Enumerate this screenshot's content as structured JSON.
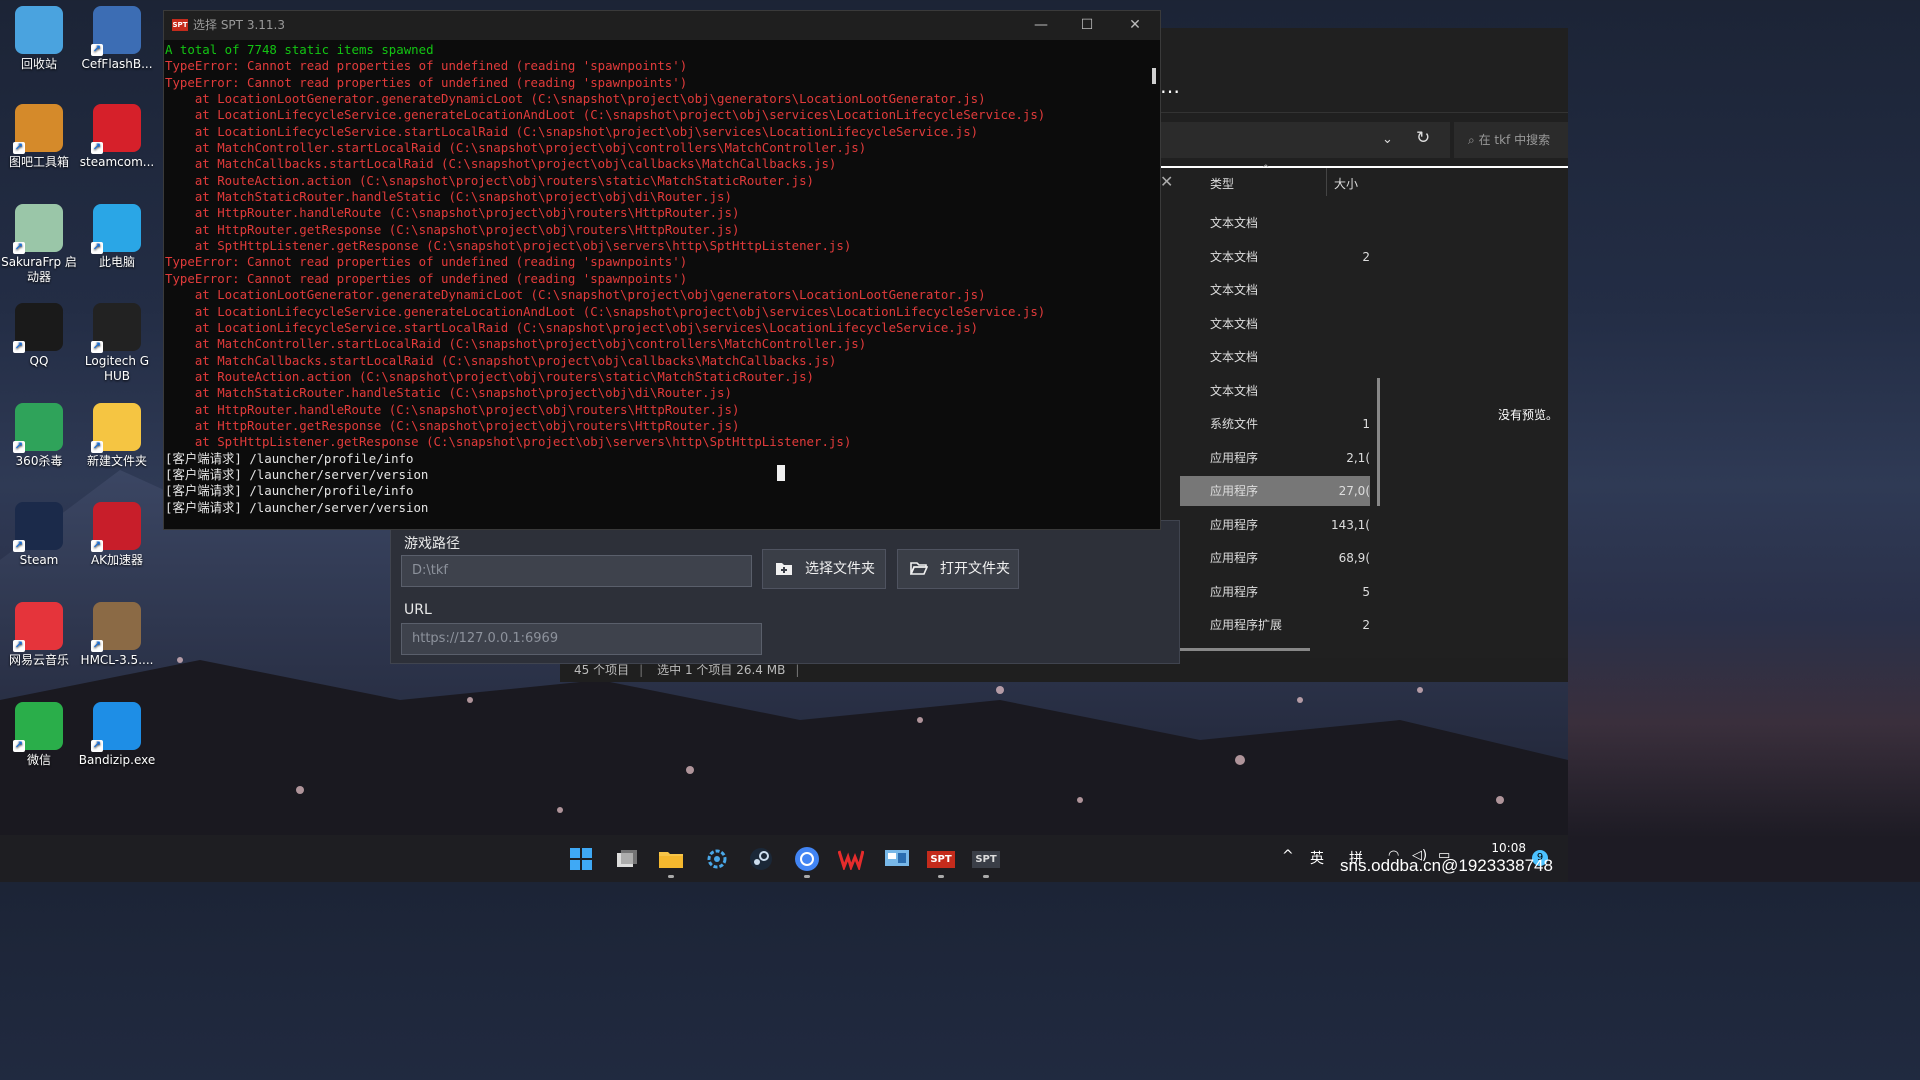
{
  "desktop": {
    "icons": [
      {
        "label": "回收站",
        "icon": "recycle-bin-icon",
        "color": "#4aa3df"
      },
      {
        "label": "CefFlashB...",
        "icon": "flash-icon",
        "color": "#3c6db4"
      },
      {
        "label": "图吧工具箱",
        "icon": "toolbox-icon",
        "color": "#d58a2a"
      },
      {
        "label": "steamcom...",
        "icon": "steamcom-icon",
        "color": "#d6202a"
      },
      {
        "label": "SakuraFrp 启动器",
        "icon": "sakurafrp-icon",
        "color": "#9ac6a8"
      },
      {
        "label": "此电脑",
        "icon": "this-pc-icon",
        "color": "#2aa6e6"
      },
      {
        "label": "QQ",
        "icon": "qq-icon",
        "color": "#1a1a1a"
      },
      {
        "label": "Logitech G HUB",
        "icon": "logitech-icon",
        "color": "#222"
      },
      {
        "label": "360杀毒",
        "icon": "360-antivirus-icon",
        "color": "#2fa35a"
      },
      {
        "label": "新建文件夹",
        "icon": "folder-icon",
        "color": "#f5c542"
      },
      {
        "label": "Steam",
        "icon": "steam-icon",
        "color": "#1b2a4a"
      },
      {
        "label": "AK加速器",
        "icon": "ak-accelerator-icon",
        "color": "#c81e2a"
      },
      {
        "label": "网易云音乐",
        "icon": "netease-music-icon",
        "color": "#e5343b"
      },
      {
        "label": "HMCL-3.5....",
        "icon": "hmcl-icon",
        "color": "#8b6a45"
      },
      {
        "label": "微信",
        "icon": "wechat-icon",
        "color": "#2aae4a"
      },
      {
        "label": "Bandizip.exe",
        "icon": "bandizip-icon",
        "color": "#1e8ee6"
      }
    ]
  },
  "console": {
    "title": "选择 SPT 3.11.3",
    "app_icon": "SPT",
    "lines": [
      {
        "c": "g",
        "t": "A total of 7748 static items spawned"
      },
      {
        "c": "r",
        "t": "TypeError: Cannot read properties of undefined (reading 'spawnpoints')"
      },
      {
        "c": "r",
        "t": "TypeError: Cannot read properties of undefined (reading 'spawnpoints')"
      },
      {
        "c": "r",
        "t": "    at LocationLootGenerator.generateDynamicLoot (C:\\snapshot\\project\\obj\\generators\\LocationLootGenerator.js)"
      },
      {
        "c": "r",
        "t": "    at LocationLifecycleService.generateLocationAndLoot (C:\\snapshot\\project\\obj\\services\\LocationLifecycleService.js)"
      },
      {
        "c": "r",
        "t": "    at LocationLifecycleService.startLocalRaid (C:\\snapshot\\project\\obj\\services\\LocationLifecycleService.js)"
      },
      {
        "c": "r",
        "t": "    at MatchController.startLocalRaid (C:\\snapshot\\project\\obj\\controllers\\MatchController.js)"
      },
      {
        "c": "r",
        "t": "    at MatchCallbacks.startLocalRaid (C:\\snapshot\\project\\obj\\callbacks\\MatchCallbacks.js)"
      },
      {
        "c": "r",
        "t": "    at RouteAction.action (C:\\snapshot\\project\\obj\\routers\\static\\MatchStaticRouter.js)"
      },
      {
        "c": "r",
        "t": "    at MatchStaticRouter.handleStatic (C:\\snapshot\\project\\obj\\di\\Router.js)"
      },
      {
        "c": "r",
        "t": "    at HttpRouter.handleRoute (C:\\snapshot\\project\\obj\\routers\\HttpRouter.js)"
      },
      {
        "c": "r",
        "t": "    at HttpRouter.getResponse (C:\\snapshot\\project\\obj\\routers\\HttpRouter.js)"
      },
      {
        "c": "r",
        "t": "    at SptHttpListener.getResponse (C:\\snapshot\\project\\obj\\servers\\http\\SptHttpListener.js)"
      },
      {
        "c": "r",
        "t": "TypeError: Cannot read properties of undefined (reading 'spawnpoints')"
      },
      {
        "c": "r",
        "t": "TypeError: Cannot read properties of undefined (reading 'spawnpoints')"
      },
      {
        "c": "r",
        "t": "    at LocationLootGenerator.generateDynamicLoot (C:\\snapshot\\project\\obj\\generators\\LocationLootGenerator.js)"
      },
      {
        "c": "r",
        "t": "    at LocationLifecycleService.generateLocationAndLoot (C:\\snapshot\\project\\obj\\services\\LocationLifecycleService.js)"
      },
      {
        "c": "r",
        "t": "    at LocationLifecycleService.startLocalRaid (C:\\snapshot\\project\\obj\\services\\LocationLifecycleService.js)"
      },
      {
        "c": "r",
        "t": "    at MatchController.startLocalRaid (C:\\snapshot\\project\\obj\\controllers\\MatchController.js)"
      },
      {
        "c": "r",
        "t": "    at MatchCallbacks.startLocalRaid (C:\\snapshot\\project\\obj\\callbacks\\MatchCallbacks.js)"
      },
      {
        "c": "r",
        "t": "    at RouteAction.action (C:\\snapshot\\project\\obj\\routers\\static\\MatchStaticRouter.js)"
      },
      {
        "c": "r",
        "t": "    at MatchStaticRouter.handleStatic (C:\\snapshot\\project\\obj\\di\\Router.js)"
      },
      {
        "c": "r",
        "t": "    at HttpRouter.handleRoute (C:\\snapshot\\project\\obj\\routers\\HttpRouter.js)"
      },
      {
        "c": "r",
        "t": "    at HttpRouter.getResponse (C:\\snapshot\\project\\obj\\routers\\HttpRouter.js)"
      },
      {
        "c": "r",
        "t": "    at SptHttpListener.getResponse (C:\\snapshot\\project\\obj\\servers\\http\\SptHttpListener.js)"
      },
      {
        "c": "w",
        "t": "[客户端请求] /launcher/profile/info"
      },
      {
        "c": "w",
        "t": "[客户端请求] /launcher/server/version"
      },
      {
        "c": "w",
        "t": "[客户端请求] /launcher/profile/info"
      },
      {
        "c": "w",
        "t": "[客户端请求] /launcher/server/version"
      }
    ]
  },
  "launcher": {
    "game_path_label": "游戏路径",
    "game_path_value": "D:\\tkf",
    "select_folder_label": "选择文件夹",
    "open_folder_label": "打开文件夹",
    "url_label": "URL",
    "url_value": "https://127.0.0.1:6969"
  },
  "explorer": {
    "search_placeholder": "在 tkf 中搜索",
    "col_type": "类型",
    "col_size": "大小",
    "no_preview": "没有预览。",
    "rows": [
      {
        "type": "文本文档",
        "size": ""
      },
      {
        "type": "文本文档",
        "size": "2"
      },
      {
        "type": "文本文档",
        "size": ""
      },
      {
        "type": "文本文档",
        "size": ""
      },
      {
        "type": "文本文档",
        "size": ""
      },
      {
        "type": "文本文档",
        "size": ""
      },
      {
        "type": "系统文件",
        "size": "1"
      },
      {
        "type": "应用程序",
        "size": "2,1("
      },
      {
        "type": "应用程序",
        "size": "27,0("
      },
      {
        "type": "应用程序",
        "size": "143,1("
      },
      {
        "type": "应用程序",
        "size": "68,9("
      },
      {
        "type": "应用程序",
        "size": "5"
      },
      {
        "type": "应用程序扩展",
        "size": "2"
      }
    ],
    "selected_row": 8,
    "status": {
      "count": "45 个项目",
      "selected": "选中 1 个项目  26.4 MB"
    }
  },
  "taskbar": {
    "apps": [
      "start-icon",
      "task-view-icon",
      "file-explorer-icon",
      "settings-icon",
      "steam-icon",
      "chrome-icon",
      "wps-icon",
      "control-panel-icon",
      "spt-server-icon",
      "spt-launcher-icon"
    ],
    "spt_label": "SPT",
    "tray": {
      "chevron": "^",
      "lang": "英",
      "ime": "拼"
    },
    "time": "10:08",
    "notifications": "9"
  },
  "watermark": "sns.oddba.cn@1923338748"
}
